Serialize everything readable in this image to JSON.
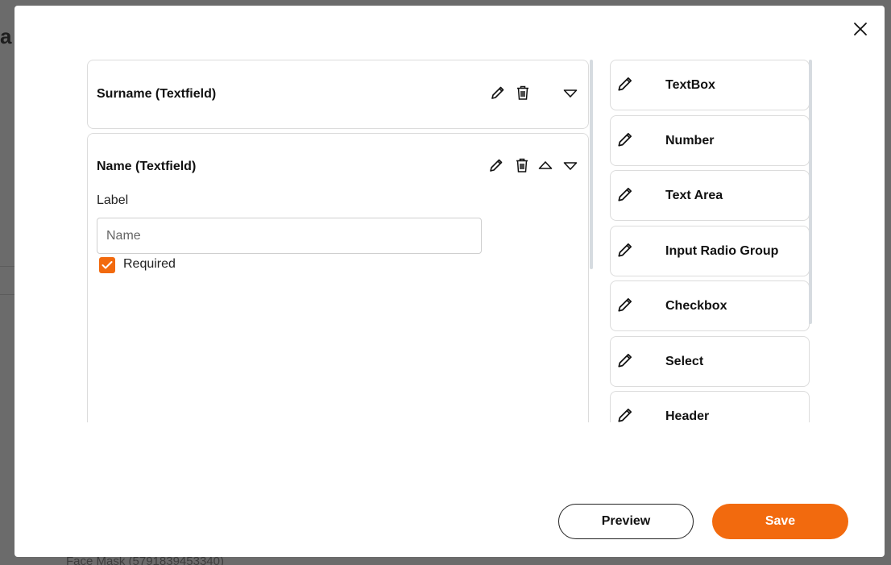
{
  "background": {
    "heading_fragment": "a",
    "footer_text": "Face Mask (5791839453340)"
  },
  "modal": {
    "close_icon": "close-icon",
    "fields": [
      {
        "title": "Surname (Textfield)",
        "expanded": false
      },
      {
        "title": "Name (Textfield)",
        "expanded": true,
        "label_caption": "Label",
        "label_value": "Name",
        "required_label": "Required",
        "required_checked": true
      }
    ],
    "palette": [
      {
        "label": "TextBox",
        "icon": "pencil-icon"
      },
      {
        "label": "Number",
        "icon": "pencil-icon"
      },
      {
        "label": "Text Area",
        "icon": "pencil-icon"
      },
      {
        "label": "Input Radio Group",
        "icon": "pencil-icon"
      },
      {
        "label": "Checkbox",
        "icon": "pencil-icon"
      },
      {
        "label": "Select",
        "icon": "pencil-icon"
      },
      {
        "label": "Header",
        "icon": "pencil-icon"
      }
    ],
    "buttons": {
      "preview_label": "Preview",
      "save_label": "Save"
    }
  },
  "colors": {
    "accent": "#f26a0e",
    "border": "#dcdcdc",
    "overlay": "#6b6b6b"
  }
}
